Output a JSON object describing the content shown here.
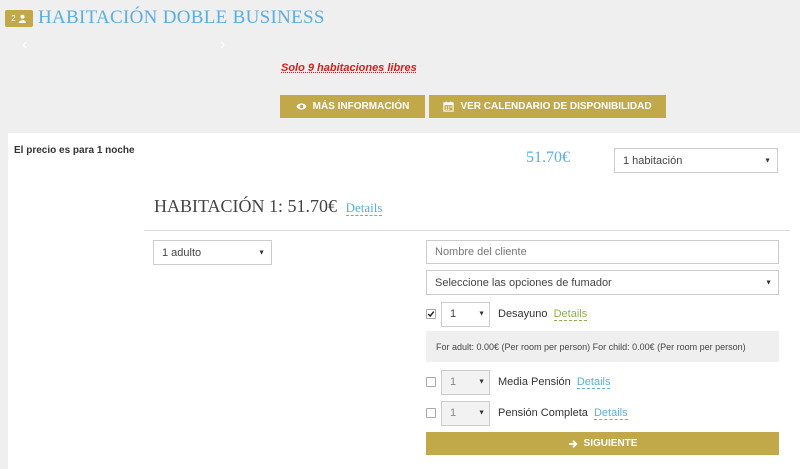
{
  "room": {
    "number": "2",
    "title": "HABITACIÓN DOBLE BUSINESS",
    "availability": "Solo 9 habitaciones libres"
  },
  "buttons": {
    "more_info": "MÁS INFORMACIÓN",
    "calendar": "VER CALENDARIO DE DISPONIBILIDAD",
    "next": "SIGUIENTE"
  },
  "booking": {
    "price_note": "El precio es para 1 noche",
    "total_price": "51.70€",
    "rooms_select": "1 habitación",
    "room_heading": "HABITACIÓN 1: 51.70€",
    "details_label": "Details",
    "adults_select": "1 adulto",
    "name_placeholder": "Nombre del cliente",
    "smoking_select": "Seleccione las opciones de fumador"
  },
  "options": [
    {
      "qty": "1",
      "label": "Desayuno",
      "details": "Details",
      "checked": true
    },
    {
      "qty": "1",
      "label": "Media Pensión",
      "details": "Details",
      "checked": false
    },
    {
      "qty": "1",
      "label": "Pensión Completa",
      "details": "Details",
      "checked": false
    }
  ],
  "breakfast_info": "For adult: 0.00€ (Per room per person) For child: 0.00€ (Per room per person)",
  "colors": {
    "accent_gold": "#c1a94a",
    "link_blue": "#5aaee0",
    "alert_red": "#d41e1e",
    "details_green": "#8db04a"
  },
  "icons": [
    "user-icon",
    "eye-icon",
    "calendar-icon",
    "arrow-right-icon",
    "chevron-left-icon",
    "chevron-right-icon",
    "checkmark-icon"
  ]
}
